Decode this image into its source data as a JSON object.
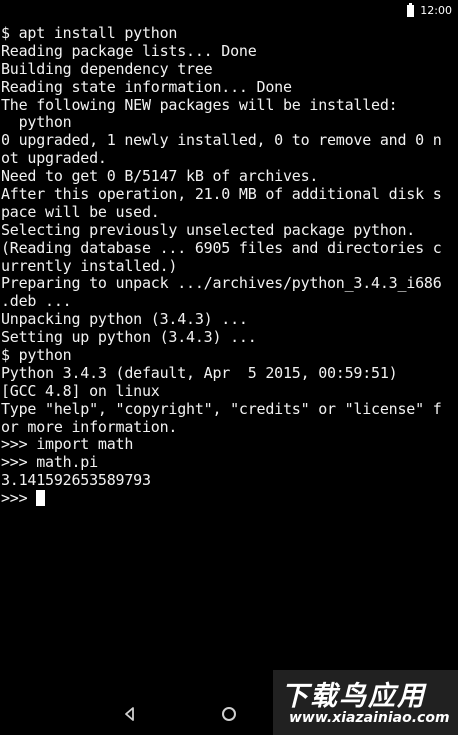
{
  "status_bar": {
    "time": "12:00",
    "battery_icon": "battery-icon"
  },
  "terminal": {
    "lines": [
      "$ apt install python",
      "Reading package lists... Done",
      "Building dependency tree",
      "Reading state information... Done",
      "The following NEW packages will be installed:",
      "  python",
      "0 upgraded, 1 newly installed, 0 to remove and 0 n",
      "ot upgraded.",
      "Need to get 0 B/5147 kB of archives.",
      "After this operation, 21.0 MB of additional disk s",
      "pace will be used.",
      "Selecting previously unselected package python.",
      "(Reading database ... 6905 files and directories c",
      "urrently installed.)",
      "Preparing to unpack .../archives/python_3.4.3_i686",
      ".deb ...",
      "Unpacking python (3.4.3) ...",
      "Setting up python (3.4.3) ...",
      "$ python",
      "Python 3.4.3 (default, Apr  5 2015, 00:59:51)",
      "[GCC 4.8] on linux",
      "Type \"help\", \"copyright\", \"credits\" or \"license\" f",
      "or more information.",
      ">>> import math",
      ">>> math.pi",
      "3.141592653589793",
      ">>> "
    ],
    "foreground_color": "#f2f2f2",
    "background_color": "#000000"
  },
  "nav_bar": {
    "back_icon": "back-triangle-icon",
    "home_icon": "home-circle-icon"
  },
  "watermark": {
    "title": "下载鸟应用",
    "url": "www.xiazainiao.com"
  }
}
